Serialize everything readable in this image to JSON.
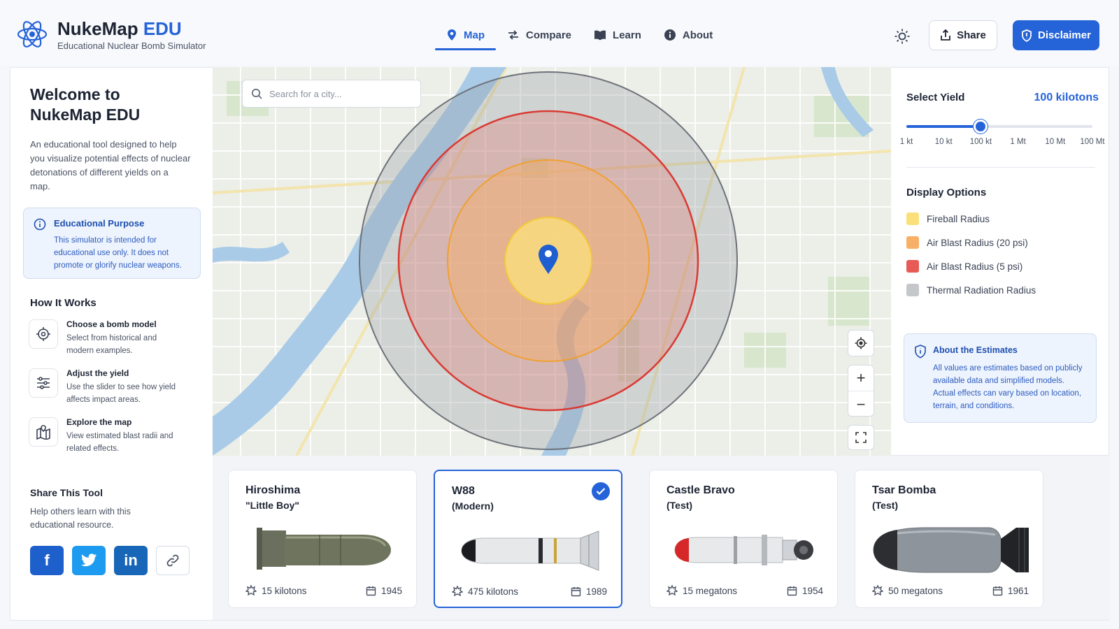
{
  "brand": {
    "title_main": "NukeMap",
    "title_accent": "EDU",
    "subtitle": "Educational Nuclear Bomb Simulator"
  },
  "nav": [
    {
      "label": "Map",
      "icon": "map-pin-icon",
      "active": true
    },
    {
      "label": "Compare",
      "icon": "swap-arrows-icon",
      "active": false
    },
    {
      "label": "Learn",
      "icon": "book-icon",
      "active": false
    },
    {
      "label": "About",
      "icon": "info-icon",
      "active": false
    }
  ],
  "header": {
    "share_label": "Share",
    "disclaimer_label": "Disclaimer"
  },
  "sidebar": {
    "welcome": "Welcome to NukeMap EDU",
    "intro": "An educational tool designed to help you visualize potential effects of nuclear detonations of different yields on a map.",
    "edu_title": "Educational Purpose",
    "edu_text": "This simulator is intended for educational use only. It does not promote or glorify nuclear weapons.",
    "how_title": "How It Works",
    "steps": [
      {
        "title": "Choose a bomb model",
        "desc": "Select from historical and modern examples.",
        "icon": "target-icon"
      },
      {
        "title": "Adjust the yield",
        "desc": "Use the slider to see how yield affects impact areas.",
        "icon": "sliders-icon"
      },
      {
        "title": "Explore the map",
        "desc": "View estimated blast radii and related effects.",
        "icon": "map-icon"
      }
    ],
    "share_title": "Share This Tool",
    "share_desc": "Help others learn with this educational resource.",
    "social": {
      "facebook": "f",
      "linkedin": "in"
    }
  },
  "map": {
    "search_placeholder": "Search for a city..."
  },
  "yield": {
    "title": "Select Yield",
    "value_label": "100 kilotons",
    "ticks": [
      "1 kt",
      "10 kt",
      "100 kt",
      "1 Mt",
      "10 Mt",
      "100 Mt"
    ],
    "position_fraction": 0.4
  },
  "display": {
    "title": "Display Options",
    "options": [
      {
        "label": "Fireball Radius",
        "color": "#fbe07a"
      },
      {
        "label": "Air Blast Radius (20 psi)",
        "color": "#f7b066"
      },
      {
        "label": "Air Blast Radius (5 psi)",
        "color": "#e85a55"
      },
      {
        "label": "Thermal Radiation Radius",
        "color": "#c5c7cb"
      }
    ]
  },
  "about": {
    "title": "About the Estimates",
    "text": "All values are estimates based on publicly available data and simplified models. Actual effects can vary based on location, terrain, and conditions."
  },
  "bombs": [
    {
      "name": "Hiroshima",
      "sub": "\"Little Boy\"",
      "yield": "15 kilotons",
      "year": "1945",
      "selected": false
    },
    {
      "name": "W88",
      "sub": "(Modern)",
      "yield": "475 kilotons",
      "year": "1989",
      "selected": true
    },
    {
      "name": "Castle Bravo",
      "sub": "(Test)",
      "yield": "15 megatons",
      "year": "1954",
      "selected": false
    },
    {
      "name": "Tsar Bomba",
      "sub": "(Test)",
      "yield": "50 megatons",
      "year": "1961",
      "selected": false
    }
  ],
  "colors": {
    "accent": "#2563d9",
    "fireball": "#fbe07a",
    "blast20": "#f7b066",
    "blast5": "#e85a55",
    "thermal": "#9aa0a6"
  }
}
